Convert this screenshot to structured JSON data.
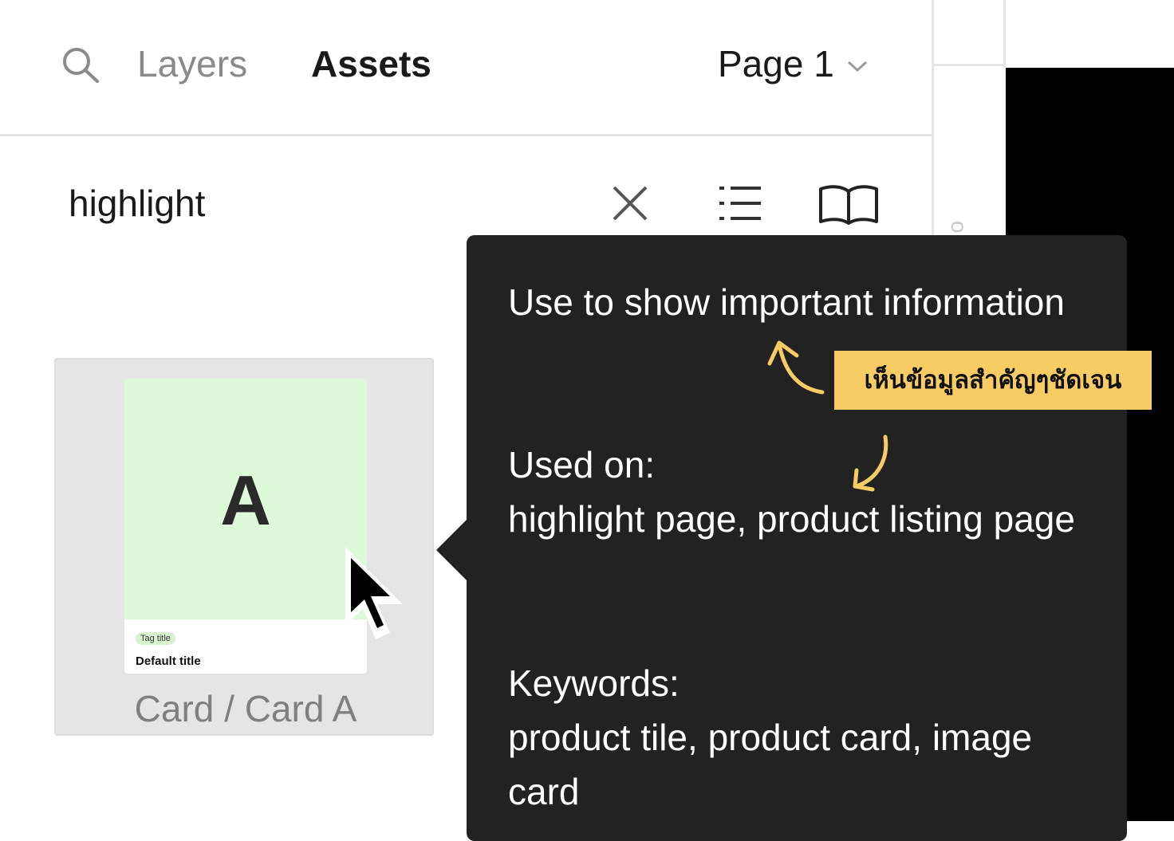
{
  "tabs": {
    "layers": "Layers",
    "assets": "Assets",
    "page_select": "Page 1"
  },
  "search": {
    "value": "highlight"
  },
  "asset": {
    "thumb_letter": "A",
    "tag_title": "Tag title",
    "default_title": "Default title",
    "name": "Card / Card A"
  },
  "tooltip": {
    "description": "Use to show important information",
    "used_on_label": "Used on:",
    "used_on_value": "highlight page, product listing page",
    "keywords_label": "Keywords:",
    "keywords_value": "product tile, product card, image card"
  },
  "annotation": {
    "text": "เห็นข้อมูลสำคัญๆชัดเจน"
  },
  "colors": {
    "tooltip_bg": "#222222",
    "annotation_bg": "#f7cc65",
    "thumb_bg": "#def9d9"
  }
}
